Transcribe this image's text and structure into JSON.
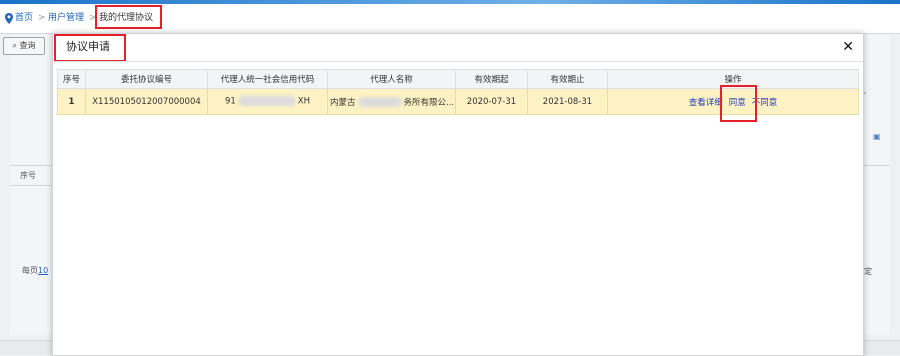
{
  "breadcrumb": {
    "home": "首页",
    "separator": ">",
    "parent": "用户管理",
    "current": "我的代理协议"
  },
  "background": {
    "search_label": "查询",
    "col_seq": "序号",
    "per_page_prefix": "每页",
    "per_page_value": "10",
    "confirm": "定"
  },
  "modal": {
    "title": "协议申请",
    "close_glyph": "✕",
    "columns": [
      "序号",
      "委托协议编号",
      "代理人统一社会信用代码",
      "代理人名称",
      "有效期起",
      "有效期止",
      "操作"
    ],
    "rows": [
      {
        "seq": "1",
        "agreement_no": "X1150105012007000004",
        "credit_code_prefix": "91",
        "credit_code_suffix": "XH",
        "agent_name_prefix": "内蒙古",
        "agent_name_suffix": "务所有限公...",
        "valid_from": "2020-07-31",
        "valid_to": "2021-08-31",
        "actions": {
          "view": "查看详细",
          "agree": "同意",
          "disagree": "不同意"
        }
      }
    ]
  },
  "colors": {
    "accent": "#1f66b8",
    "highlight_row": "#fdf2c4",
    "annotation_red": "#e5202b"
  }
}
